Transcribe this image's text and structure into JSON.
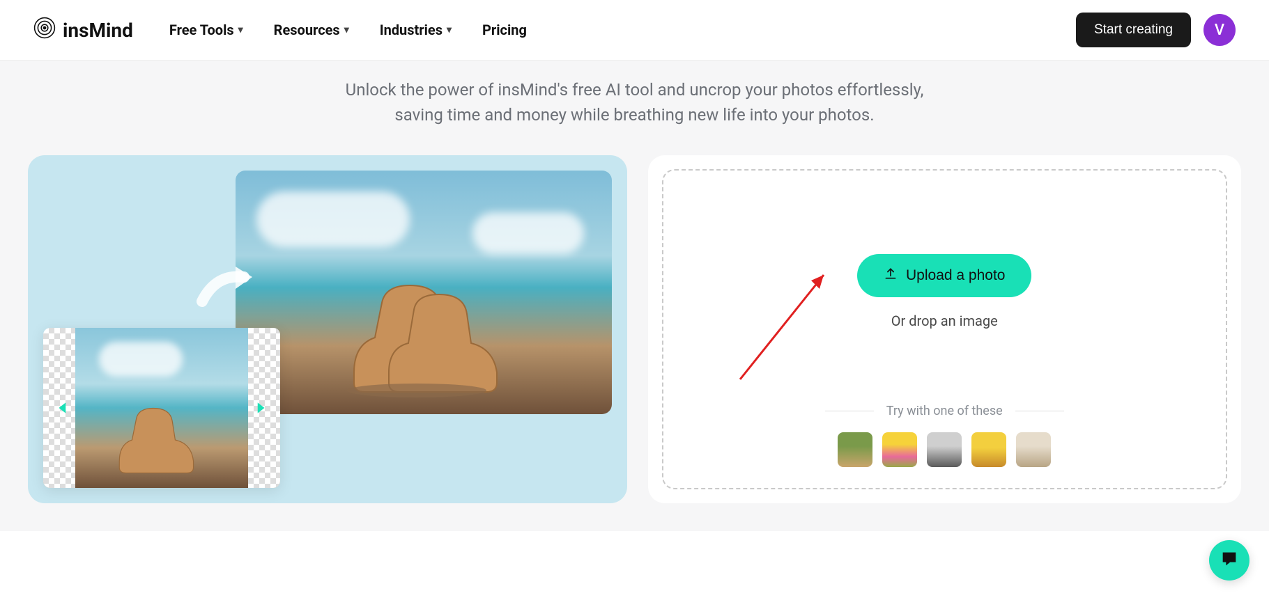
{
  "brand": {
    "name": "insMind"
  },
  "nav": {
    "items": [
      {
        "label": "Free Tools",
        "has_dropdown": true
      },
      {
        "label": "Resources",
        "has_dropdown": true
      },
      {
        "label": "Industries",
        "has_dropdown": true
      },
      {
        "label": "Pricing",
        "has_dropdown": false
      }
    ]
  },
  "header": {
    "cta_label": "Start creating",
    "avatar_initial": "V"
  },
  "hero": {
    "description": "Unlock the power of insMind's free AI tool and uncrop your photos effortlessly, saving time and money while breathing new life into your photos."
  },
  "upload": {
    "button_label": "Upload a photo",
    "drop_label": "Or drop an image",
    "try_label": "Try with one of these"
  },
  "samples": [
    {
      "name": "sample-dog"
    },
    {
      "name": "sample-girl-flowers"
    },
    {
      "name": "sample-cat"
    },
    {
      "name": "sample-field"
    },
    {
      "name": "sample-person-beach"
    }
  ],
  "colors": {
    "accent": "#19e0b6",
    "avatar_bg": "#8b2fd6",
    "panel_left_bg": "#c6e6f0"
  }
}
